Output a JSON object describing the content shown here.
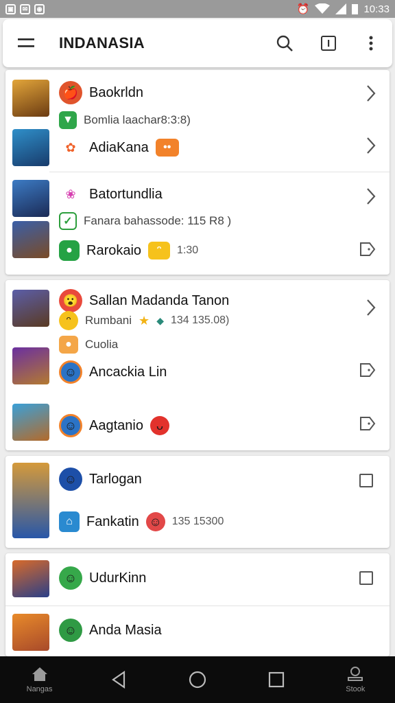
{
  "status_bar": {
    "time": "10:33"
  },
  "app_bar": {
    "title": "INDANASIA",
    "icons": [
      "menu-icon",
      "search-icon",
      "info-icon",
      "more-vert-icon"
    ]
  },
  "cards": [
    {
      "rows": [
        {
          "name": "Baokrldn",
          "sub": "",
          "meta": ""
        },
        {
          "name": "",
          "sub": "Bomlia laachar8:3:8)",
          "meta": ""
        },
        {
          "name": "AdiaKana",
          "sub": "",
          "meta": ""
        }
      ]
    },
    {
      "rows": [
        {
          "name": "Batortundlia",
          "sub": "",
          "meta": ""
        },
        {
          "name": "",
          "sub": "Fanara bahassode: 115 R8 )",
          "meta": ""
        },
        {
          "name": "Rarokaio",
          "sub": "",
          "meta": "1:30"
        }
      ]
    },
    {
      "rows": [
        {
          "name": "Sallan Madanda Tanon",
          "sub": "",
          "meta": ""
        },
        {
          "name": "Rumbani",
          "sub": "",
          "meta": "134 135.08)"
        },
        {
          "name": "",
          "sub": "Cuolia",
          "meta": ""
        },
        {
          "name": "Ancackia Lin",
          "sub": "",
          "meta": ""
        },
        {
          "name": "Aagtanio",
          "sub": "",
          "meta": ""
        }
      ]
    },
    {
      "rows": [
        {
          "name": "Tarlogan",
          "sub": "",
          "meta": ""
        },
        {
          "name": "Fankatin",
          "sub": "",
          "meta": "135 15300"
        }
      ]
    },
    {
      "rows": [
        {
          "name": "UdurKinn",
          "sub": "",
          "meta": ""
        },
        {
          "name": "Anda Masia",
          "sub": "",
          "meta": ""
        }
      ]
    }
  ],
  "nav_bar": {
    "items": [
      {
        "label": "Nangas",
        "icon": "home-icon"
      },
      {
        "label": "",
        "icon": "back-icon"
      },
      {
        "label": "",
        "icon": "home-circle-icon"
      },
      {
        "label": "",
        "icon": "recents-icon"
      },
      {
        "label": "Stook",
        "icon": "profile-icon"
      }
    ]
  }
}
